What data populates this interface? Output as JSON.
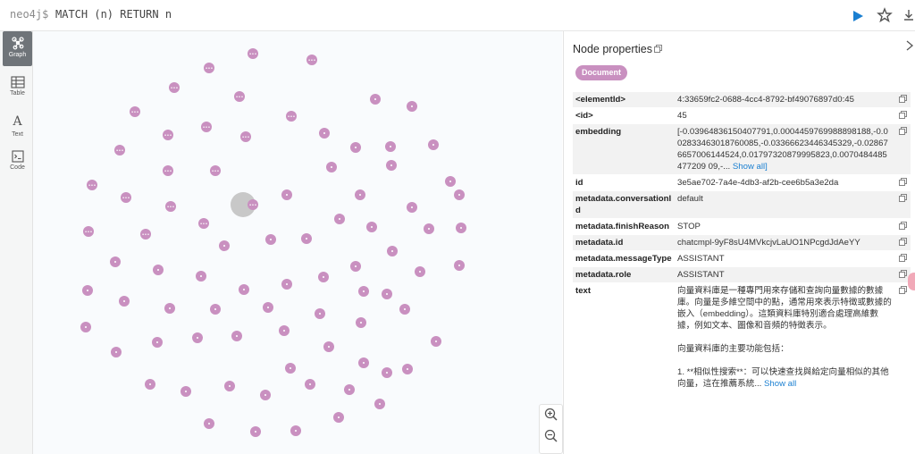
{
  "editor": {
    "prompt": "neo4j$",
    "query": "MATCH (n) RETURN n"
  },
  "sidebar": {
    "items": [
      {
        "label": "Graph",
        "icon": "graph-icon"
      },
      {
        "label": "Table",
        "icon": "table-icon"
      },
      {
        "label": "Text",
        "icon": "text-icon"
      },
      {
        "label": "Code",
        "icon": "code-icon"
      }
    ]
  },
  "canvas": {
    "node_label": "•••",
    "node_color": "#c990c0",
    "selected_node_ring": "#c8c8c8"
  },
  "panel": {
    "title": "Node properties",
    "label_chip": "Document",
    "properties": [
      {
        "key": "<elementId>",
        "value": "4:33659fc2-0688-4cc4-8792-bf49076897d0:45"
      },
      {
        "key": "<id>",
        "value": "45"
      },
      {
        "key": "embedding",
        "value": "[-0.03964836150407791,0.0004459769988898188,-0.002833463018760085,-0.03366623446345329,-0.028676657006144524,0.01797320879995823,0.0070484485477209 09,-...",
        "more": "Show all]"
      },
      {
        "key": "id",
        "value": "3e5ae702-7a4e-4db3-af2b-cee6b5a3e2da"
      },
      {
        "key": "metadata.conversationId",
        "value": "default"
      },
      {
        "key": "metadata.finishReason",
        "value": "STOP"
      },
      {
        "key": "metadata.id",
        "value": "chatcmpl-9yF8sU4MVkcjvLaUO1NPcgdJdAeYY"
      },
      {
        "key": "metadata.messageType",
        "value": "ASSISTANT"
      },
      {
        "key": "metadata.role",
        "value": "ASSISTANT"
      },
      {
        "key": "text",
        "value": "向量資料庫是一種專門用來存儲和查詢向量數據的數據庫。向量是多維空間中的點，通常用來表示特徵或數據的嵌入（embedding）。這類資料庫特別適合處理高維數據，例如文本、圖像和音頻的特徵表示。\n\n向量資料庫的主要功能包括：\n\n1. **相似性搜索**：可以快速查找與給定向量相似的其他向量，這在推薦系統...",
        "more": "Show all"
      }
    ]
  },
  "colors": {
    "accent": "#1a7fd1",
    "node": "#c990c0",
    "run": "#1a7fd1"
  }
}
